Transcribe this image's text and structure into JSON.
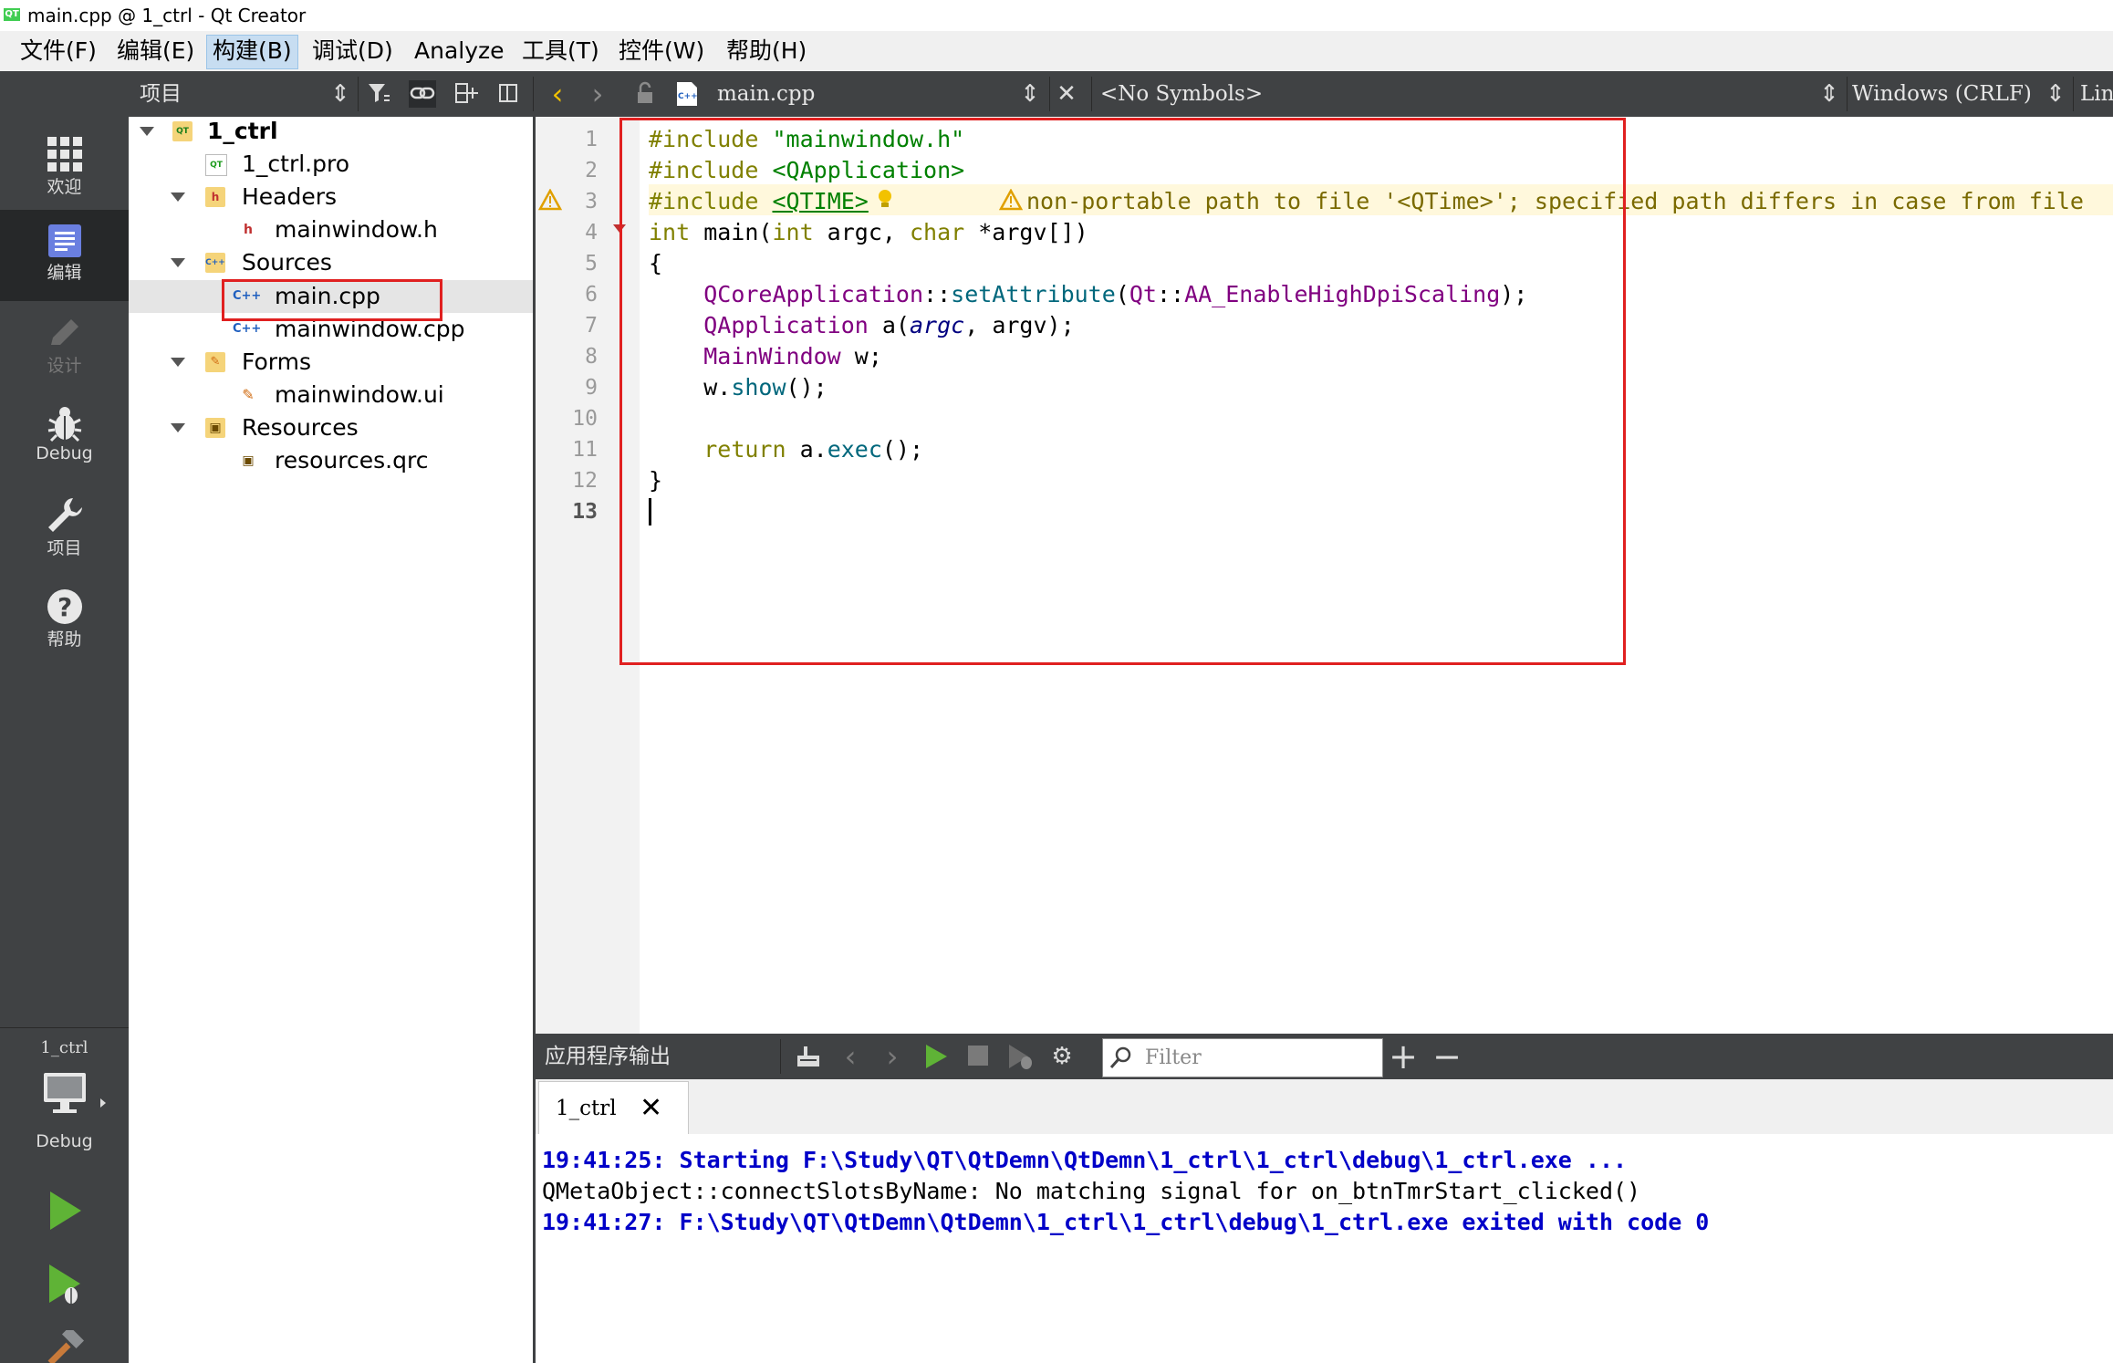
{
  "window": {
    "title": "main.cpp @ 1_ctrl - Qt Creator",
    "logo_text": "QT"
  },
  "menu": [
    {
      "label": "文件(F)"
    },
    {
      "label": "编辑(E)"
    },
    {
      "label": "构建(B)"
    },
    {
      "label": "调试(D)"
    },
    {
      "label": "Analyze"
    },
    {
      "label": "工具(T)"
    },
    {
      "label": "控件(W)"
    },
    {
      "label": "帮助(H)"
    }
  ],
  "project_panel": {
    "title": "项目"
  },
  "editor_toolbar": {
    "filename": "main.cpp",
    "file_icon": "C++",
    "symbols": "<No Symbols>",
    "line_ending": "Windows (CRLF)",
    "cursor_pos": "Lin"
  },
  "modes": [
    {
      "label": "欢迎",
      "icon": "grid-icon"
    },
    {
      "label": "编辑",
      "icon": "edit-doc-icon"
    },
    {
      "label": "设计",
      "icon": "pencil-icon"
    },
    {
      "label": "Debug",
      "icon": "bug-icon"
    },
    {
      "label": "项目",
      "icon": "wrench-icon"
    },
    {
      "label": "帮助",
      "icon": "help-icon"
    }
  ],
  "kit": {
    "project": "1_ctrl",
    "build": "Debug"
  },
  "tree": {
    "root": "1_ctrl",
    "pro_file": "1_ctrl.pro",
    "headers": "Headers",
    "header_file": "mainwindow.h",
    "sources": "Sources",
    "source_main": "main.cpp",
    "source_mainwindow": "mainwindow.cpp",
    "forms": "Forms",
    "form_file": "mainwindow.ui",
    "resources": "Resources",
    "resource_file": "resources.qrc",
    "file_icons": {
      "cpp": "C++",
      "header": "h",
      "pro": "QT"
    }
  },
  "code": {
    "line_numbers": [
      "1",
      "2",
      "3",
      "4",
      "5",
      "6",
      "7",
      "8",
      "9",
      "10",
      "11",
      "12",
      "13"
    ],
    "warning": "non-portable path to file '<QTime>'; specified path differs in case from file"
  },
  "output": {
    "title": "应用程序输出",
    "filter_placeholder": "Filter",
    "tab": "1_ctrl",
    "lines": [
      "19:41:25: Starting F:\\Study\\QT\\QtDemn\\QtDemn\\1_ctrl\\1_ctrl\\debug\\1_ctrl.exe ...",
      "QMetaObject::connectSlotsByName: No matching signal for on_btnTmrStart_clicked()",
      "19:41:27: F:\\Study\\QT\\QtDemn\\QtDemn\\1_ctrl\\1_ctrl\\debug\\1_ctrl.exe exited with code 0"
    ]
  },
  "colors": {
    "dark_bg": "#404244",
    "active_mode": "#262829",
    "highlight_box": "#e02020",
    "run_green": "#5fb336",
    "output_blue": "#0000c8"
  }
}
